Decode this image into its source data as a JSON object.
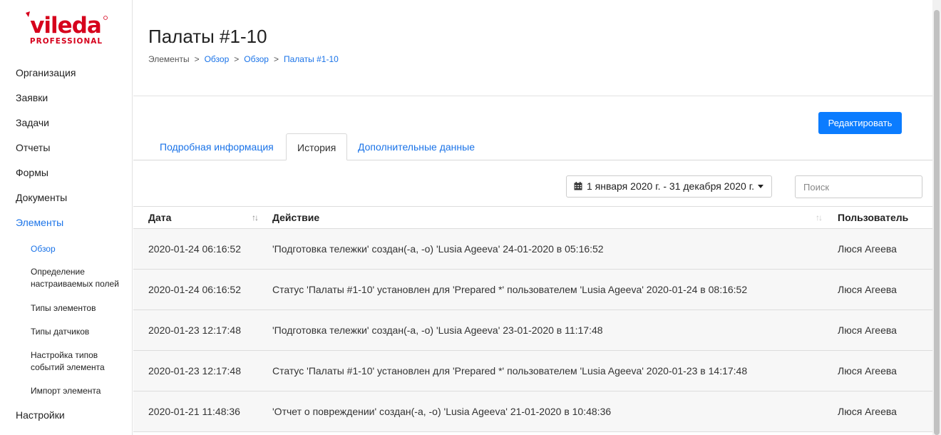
{
  "logo": {
    "brand": "vileda",
    "sub": "PROFESSIONAL",
    "color": "#d6001c"
  },
  "sidebar": {
    "items": [
      {
        "label": "Организация"
      },
      {
        "label": "Заявки"
      },
      {
        "label": "Задачи"
      },
      {
        "label": "Отчеты"
      },
      {
        "label": "Формы"
      },
      {
        "label": "Документы"
      },
      {
        "label": "Элементы",
        "active": true
      }
    ],
    "subitems": [
      {
        "label": "Обзор",
        "active": true
      },
      {
        "label": "Определение настраиваемых полей"
      },
      {
        "label": "Типы элементов"
      },
      {
        "label": "Типы датчиков"
      },
      {
        "label": "Настройка типов событий элемента"
      },
      {
        "label": "Импорт элемента"
      }
    ],
    "settings": "Настройки"
  },
  "header": {
    "title": "Палаты #1-10",
    "breadcrumb": [
      "Элементы",
      "Обзор",
      "Обзор",
      "Палаты #1-10"
    ]
  },
  "edit_button": "Редактировать",
  "tabs": [
    {
      "label": "Подробная информация"
    },
    {
      "label": "История",
      "active": true
    },
    {
      "label": "Дополнительные данные"
    }
  ],
  "filters": {
    "date_range": "1 января 2020 г. - 31 декабря 2020 г.",
    "search_placeholder": "Поиск"
  },
  "table": {
    "columns": [
      "Дата",
      "Действие",
      "Пользователь"
    ],
    "rows": [
      {
        "date": "2020-01-24 06:16:52",
        "action": "'Подготовка тележки' создан(-а, -о) 'Lusia Ageeva' 24-01-2020 в 05:16:52",
        "user": "Люся Агеева"
      },
      {
        "date": "2020-01-24 06:16:52",
        "action": "Статус 'Палаты #1-10' установлен для 'Prepared *' пользователем 'Lusia Ageeva' 2020-01-24 в 08:16:52",
        "user": "Люся Агеева"
      },
      {
        "date": "2020-01-23 12:17:48",
        "action": "'Подготовка тележки' создан(-а, -о) 'Lusia Ageeva' 23-01-2020 в 11:17:48",
        "user": "Люся Агеева"
      },
      {
        "date": "2020-01-23 12:17:48",
        "action": "Статус 'Палаты #1-10' установлен для 'Prepared *' пользователем 'Lusia Ageeva' 2020-01-23 в 14:17:48",
        "user": "Люся Агеева"
      },
      {
        "date": "2020-01-21 11:48:36",
        "action": "'Отчет о повреждении' создан(-а, -о) 'Lusia Ageeva' 21-01-2020 в 10:48:36",
        "user": "Люся Агеева"
      }
    ]
  },
  "colors": {
    "accent": "#1a73e8",
    "button": "#0b7cff"
  }
}
